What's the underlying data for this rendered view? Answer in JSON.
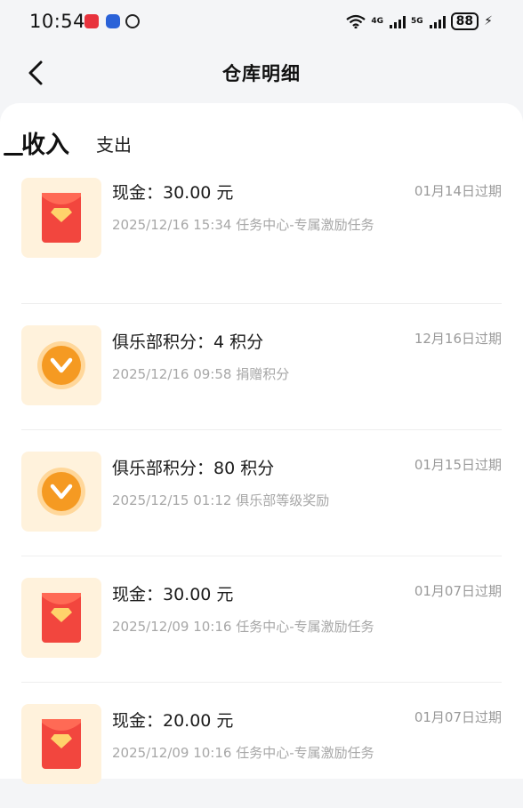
{
  "status": {
    "time": "10:54",
    "net1": "4G",
    "net2": "5G",
    "battery": "88"
  },
  "header": {
    "title": "仓库明细"
  },
  "tabs": [
    {
      "label": "收入",
      "active": true
    },
    {
      "label": "支出",
      "active": false
    }
  ],
  "records": [
    {
      "icon": "red-envelope-icon",
      "title": "现金：30.00 元",
      "expire": "01月14日过期",
      "meta": "2025/12/16 15:34 任务中心-专属激励任务"
    },
    {
      "icon": "points-coin-icon",
      "title": "俱乐部积分：4 积分",
      "expire": "12月16日过期",
      "meta": "2025/12/16 09:58 捐赠积分"
    },
    {
      "icon": "points-coin-icon",
      "title": "俱乐部积分：80 积分",
      "expire": "01月15日过期",
      "meta": "2025/12/15 01:12 俱乐部等级奖励"
    },
    {
      "icon": "red-envelope-icon",
      "title": "现金：30.00 元",
      "expire": "01月07日过期",
      "meta": "2025/12/09 10:16 任务中心-专属激励任务"
    },
    {
      "icon": "red-envelope-icon",
      "title": "现金：20.00 元",
      "expire": "01月07日过期",
      "meta": "2025/12/09 10:16 任务中心-专属激励任务"
    }
  ],
  "colors": {
    "thumb_bg": "#fff2dc",
    "envelope": "#f2463e",
    "coin": "#f59a22"
  }
}
